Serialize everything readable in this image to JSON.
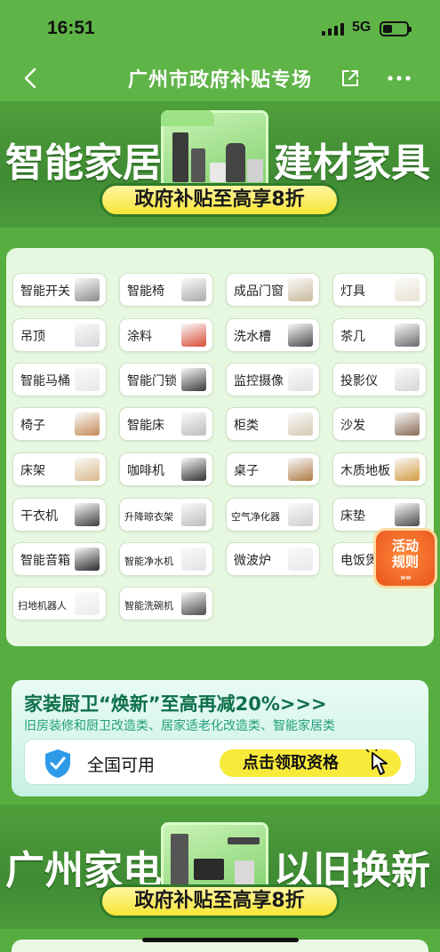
{
  "status_bar": {
    "time": "16:51",
    "network": "5G"
  },
  "nav": {
    "title": "广州市政府补贴专场"
  },
  "banner_top": {
    "left_text": "智能家居",
    "right_text": "建材家具",
    "pill_text": "政府补贴至高享8折"
  },
  "categories": [
    {
      "label": "智能开关",
      "thumb": "#8c8c8c"
    },
    {
      "label": "智能椅",
      "thumb": "#a9a9a9"
    },
    {
      "label": "成品门窗",
      "thumb": "#c9b79a"
    },
    {
      "label": "灯具",
      "thumb": "#e9e2d2"
    },
    {
      "label": "吊顶",
      "thumb": "#d8d8d8"
    },
    {
      "label": "涂料",
      "thumb": "#d94a36"
    },
    {
      "label": "洗水槽",
      "thumb": "#4a4a4a"
    },
    {
      "label": "茶几",
      "thumb": "#6a6a6a"
    },
    {
      "label": "智能马桶",
      "thumb": "#e8e8e8"
    },
    {
      "label": "智能门锁",
      "thumb": "#3a3a3a"
    },
    {
      "label": "监控摄像",
      "thumb": "#e0e0e0"
    },
    {
      "label": "投影仪",
      "thumb": "#d6d6d6"
    },
    {
      "label": "椅子",
      "thumb": "#c48a55"
    },
    {
      "label": "智能床",
      "thumb": "#bdbdbd"
    },
    {
      "label": "柜类",
      "thumb": "#d6c9b3"
    },
    {
      "label": "沙发",
      "thumb": "#8a6a52"
    },
    {
      "label": "床架",
      "thumb": "#d9b98a"
    },
    {
      "label": "咖啡机",
      "thumb": "#2f2f2f"
    },
    {
      "label": "桌子",
      "thumb": "#b07a45"
    },
    {
      "label": "木质地板",
      "thumb": "#d29a3e"
    },
    {
      "label": "干衣机",
      "thumb": "#3d3d3d"
    },
    {
      "label": "升降晾衣架",
      "thumb": "#bcbcbc"
    },
    {
      "label": "空气净化器",
      "thumb": "#cfcfcf"
    },
    {
      "label": "床垫",
      "thumb": "#4a4a4a"
    },
    {
      "label": "智能音箱",
      "thumb": "#2a2a2a"
    },
    {
      "label": "智能净水机",
      "thumb": "#e4e4e4"
    },
    {
      "label": "微波炉",
      "thumb": "#e8e8e8"
    },
    {
      "label": "电饭煲",
      "thumb": "#d0d0d0"
    },
    {
      "label": "扫地机器人",
      "thumb": "#ececec"
    },
    {
      "label": "智能洗碗机",
      "thumb": "#4a4a4a"
    }
  ],
  "activity_badge": {
    "line1": "活动",
    "line2": "规则",
    "chevrons": "»»"
  },
  "renovation": {
    "title": "家装厨卫“焕新”至高再减20%>>>",
    "subtitle": "旧房装修和厨卫改造类、居家适老化改造类、智能家居类",
    "scope": "全国可用",
    "claim_label": "点击领取资格"
  },
  "banner_bottom": {
    "left_text": "广州家电",
    "right_text": "以旧换新",
    "pill_text": "政府补贴至高享8折"
  },
  "colors": {
    "page_bg": "#58ad41",
    "card_bg": "#e6f8df",
    "pill_yellow": "#f7e535",
    "badge_orange": "#e8541a",
    "reno_green": "#0e6f4a"
  }
}
